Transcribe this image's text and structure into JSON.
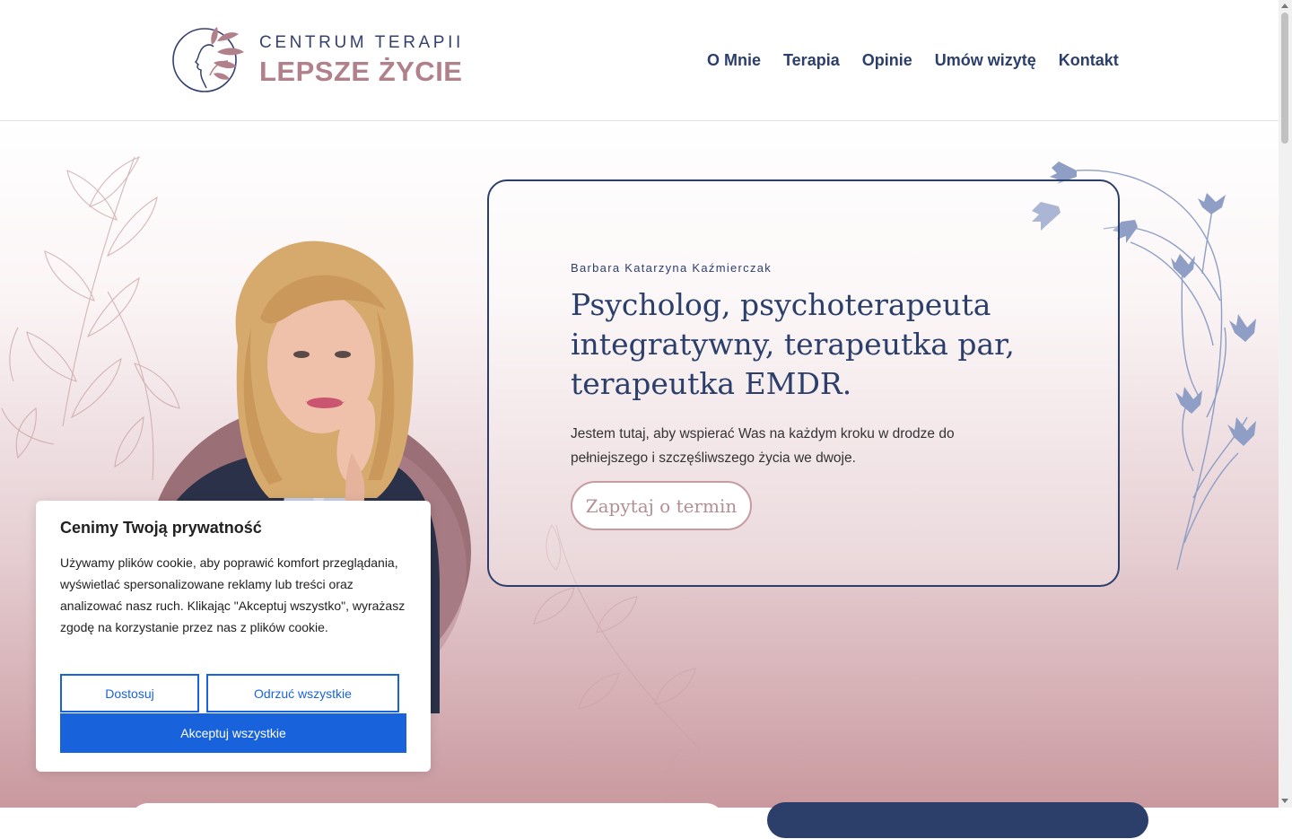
{
  "logo": {
    "line1": "CENTRUM TERAPII",
    "line2": "LEPSZE ŻYCIE",
    "icon": "head-with-leaves-icon"
  },
  "nav": {
    "items": [
      "O Mnie",
      "Terapia",
      "Opinie",
      "Umów wizytę",
      "Kontakt"
    ]
  },
  "hero": {
    "name": "Barbara Katarzyna Kaźmierczak",
    "title": "Psycholog, psychoterapeuta integratywny, terapeutka par, terapeutka EMDR.",
    "text": "Jestem tutaj, aby wspierać Was na każdym kroku w drodze do pełniejszego i szczęśliwszego życia we dwoje.",
    "button": "Zapytaj o termin"
  },
  "cookie": {
    "title": "Cenimy Twoją prywatność",
    "text": "Używamy plików cookie, aby poprawić komfort przeglądania, wyświetlać spersonalizowane reklamy lub treści oraz analizować nasz ruch. Klikając \"Akceptuj wszystko\", wyrażasz zgodę na korzystanie przez nas z plików cookie.",
    "customize": "Dostosuj",
    "reject": "Odrzuć wszystkie",
    "accept": "Akceptuj wszystkie"
  },
  "colors": {
    "navy": "#2c3f6b",
    "rose": "#b0808b",
    "cookie_blue": "#1863dc"
  }
}
